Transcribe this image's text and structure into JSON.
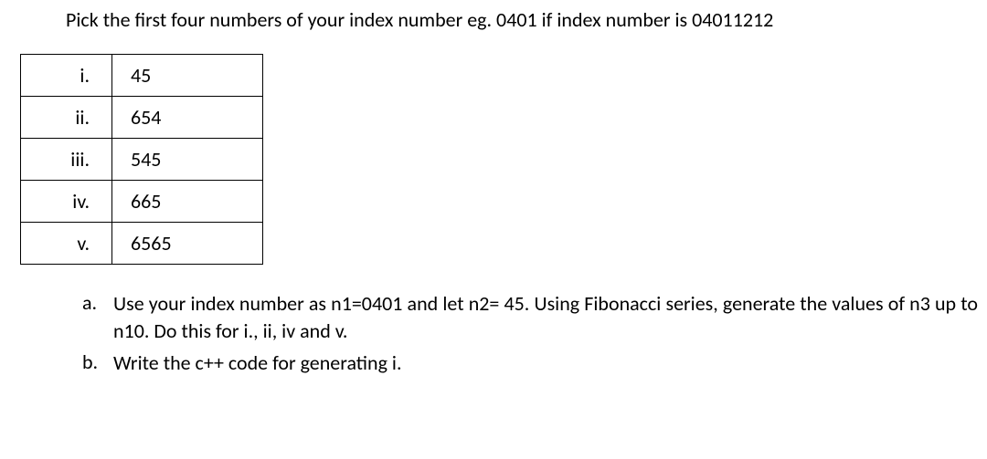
{
  "header": "Pick the first four numbers of your index number eg. 0401 if index number is 04011212",
  "table": {
    "rows": [
      {
        "label": "i.",
        "value": "45"
      },
      {
        "label": "ii.",
        "value": "654"
      },
      {
        "label": "iii.",
        "value": "545"
      },
      {
        "label": "iv.",
        "value": "665"
      },
      {
        "label": "v.",
        "value": "6565"
      }
    ]
  },
  "questions": [
    {
      "marker": "a.",
      "text": "Use your index number as n1=0401 and let n2= 45. Using Fibonacci series, generate the values of n3 up to n10. Do this for i., ii, iv and v."
    },
    {
      "marker": "b.",
      "text": "Write the c++ code for generating i."
    }
  ]
}
